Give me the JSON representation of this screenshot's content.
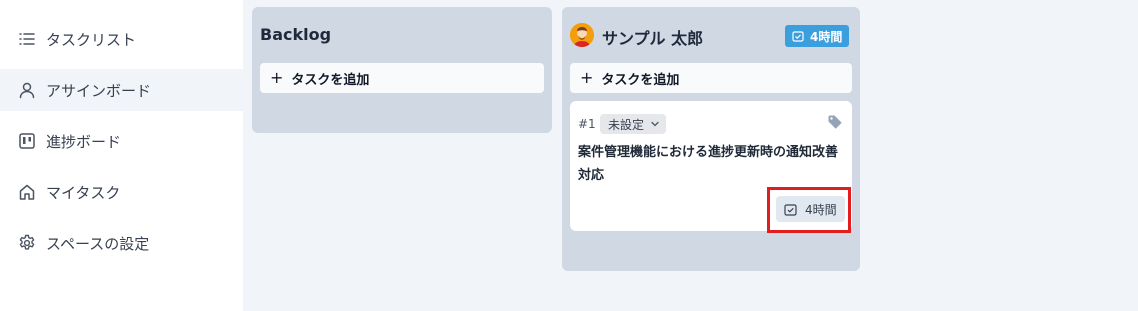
{
  "sidebar": {
    "items": [
      {
        "label": "タスクリスト",
        "icon": "list-icon"
      },
      {
        "label": "アサインボード",
        "icon": "user-icon",
        "active": true
      },
      {
        "label": "進捗ボード",
        "icon": "kanban-icon"
      },
      {
        "label": "マイタスク",
        "icon": "home-icon"
      },
      {
        "label": "スペースの設定",
        "icon": "gear-icon"
      }
    ]
  },
  "board": {
    "columns": [
      {
        "title": "Backlog",
        "add_label": "タスクを追加"
      },
      {
        "title": "サンプル 太郎",
        "hours_badge": "4時間",
        "add_label": "タスクを追加",
        "cards": [
          {
            "id": "#1",
            "status": "未設定",
            "title": "案件管理機能における進捗更新時の通知改善対応",
            "estimate": "4時間"
          }
        ]
      }
    ]
  },
  "colors": {
    "column_bg": "#cfd8e3",
    "badge_blue": "#3b9edd",
    "highlight_red": "#e11d1d"
  }
}
